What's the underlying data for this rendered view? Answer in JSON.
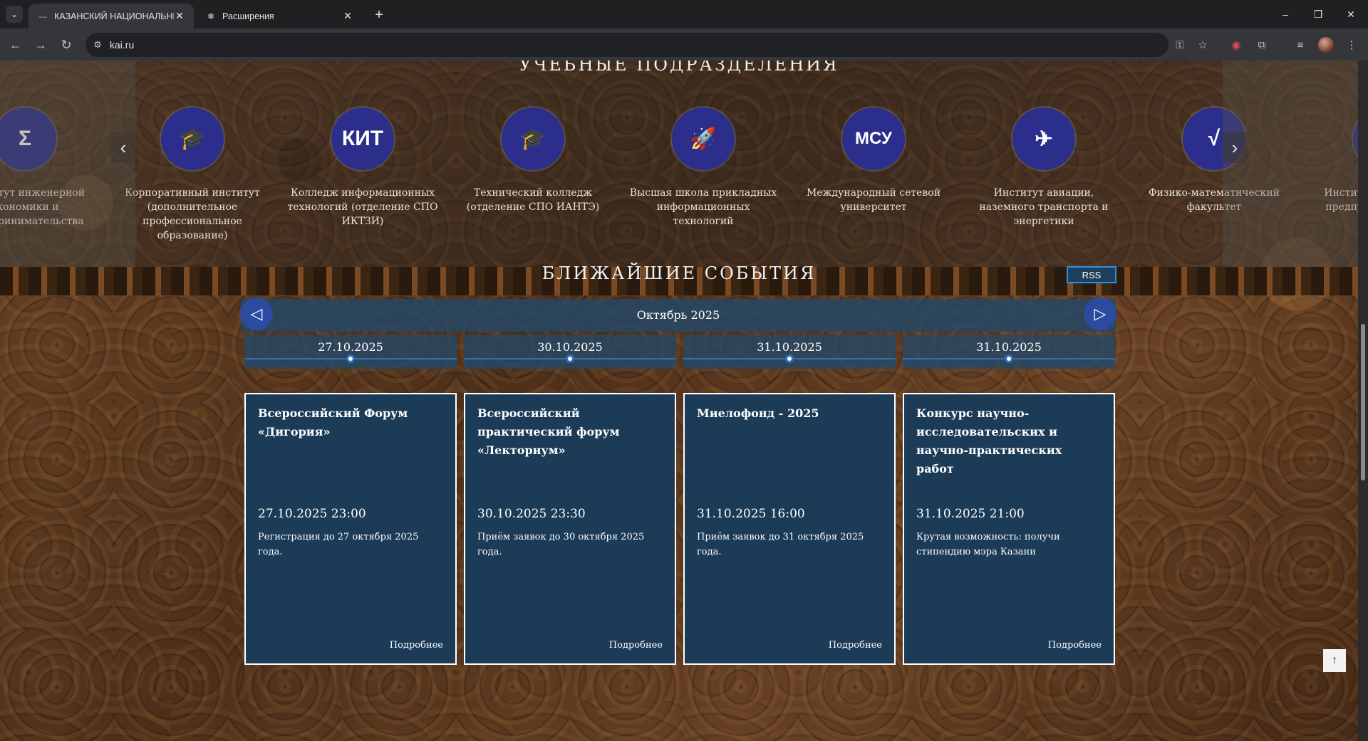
{
  "browser": {
    "tabs": [
      {
        "title": "КАЗАНСКИЙ НАЦИОНАЛЬНЫЙ",
        "active": true,
        "close": "✕"
      },
      {
        "title": "Расширения",
        "active": false,
        "close": "✕"
      }
    ],
    "tab_menu": "⌄",
    "new_tab": "+",
    "url": "kai.ru",
    "window": {
      "minimize": "–",
      "restore": "❐",
      "close": "✕"
    },
    "icons": {
      "back": "←",
      "forward": "→",
      "reload": "↻",
      "site_info": "⚙",
      "key": "⚿",
      "star": "☆",
      "record": "◉",
      "extensions": "⧉",
      "media": "≡",
      "menu": "⋮"
    }
  },
  "divisions": {
    "title": "УЧЕБНЫЕ ПОДРАЗДЕЛЕНИЯ",
    "prev": "‹",
    "next": "›",
    "items": [
      {
        "icon": "Σ",
        "label": "Институт инженерной экономики и предпринимательства"
      },
      {
        "icon": "🎓",
        "label": "Корпоративный институт (дополнительное профессиональное образование)"
      },
      {
        "icon": "КИТ",
        "label": "Колледж информационных технологий (отделение СПО ИКТЗИ)"
      },
      {
        "icon": "🎓",
        "label": "Технический колледж (отделение СПО ИАНТЭ)"
      },
      {
        "icon": "🚀",
        "label": "Высшая школа прикладных информационных технологий"
      },
      {
        "icon": "МСУ",
        "label": "Международный сетевой университет"
      },
      {
        "icon": "✈",
        "label": "Институт авиации, наземного транспорта и энергетики"
      },
      {
        "icon": "√",
        "label": "Физико-математический факультет"
      },
      {
        "icon": "",
        "label": "Институт экономики и предпринимательства"
      }
    ]
  },
  "events": {
    "title": "БЛИЖАЙШИЕ СОБЫТИЯ",
    "rss": "RSS",
    "month": "Октябрь 2025",
    "prev": "◁",
    "next": "▷",
    "more_label": "Подробнее",
    "items": [
      {
        "date": "27.10.2025",
        "title": "Всероссийский Форум «Дигория»",
        "time": "27.10.2025 23:00",
        "desc": "Регистрация до 27 октября 2025 года."
      },
      {
        "date": "30.10.2025",
        "title": "Всероссийский практический форум «Лекториум»",
        "time": "30.10.2025 23:30",
        "desc": "Приём заявок до 30 октября 2025 года."
      },
      {
        "date": "31.10.2025",
        "title": "Миелофонд - 2025",
        "time": "31.10.2025 16:00",
        "desc": "Приём заявок до 31 октября 2025 года."
      },
      {
        "date": "31.10.2025",
        "title": "Конкурс научно-исследовательских и научно-практических работ",
        "time": "31.10.2025 21:00",
        "desc": "Крутая возможность: получи стипендию мэра Казани"
      }
    ]
  },
  "to_top": "↑"
}
